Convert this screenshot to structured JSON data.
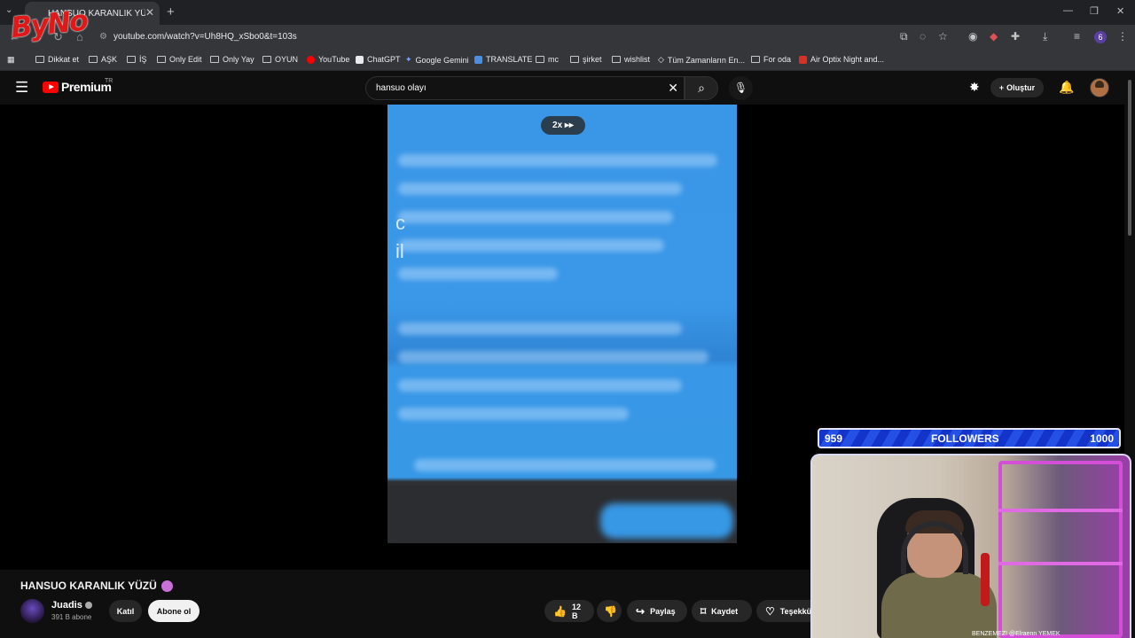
{
  "overlay": {
    "logo_text": "ByNo"
  },
  "browser": {
    "tab_title": "HANSUO KARANLIK YÜZÜ - YouTube",
    "url": "youtube.com/watch?v=Uh8HQ_xSbo0&t=103s",
    "profile_initial": "6",
    "bookmarks": [
      {
        "label": "Dikkat et",
        "icon": "folder"
      },
      {
        "label": "AŞK",
        "icon": "folder"
      },
      {
        "label": "İŞ",
        "icon": "folder"
      },
      {
        "label": "Only Edit",
        "icon": "folder"
      },
      {
        "label": "Only Yay",
        "icon": "folder"
      },
      {
        "label": "OYUN",
        "icon": "folder"
      },
      {
        "label": "YouTube",
        "icon": "youtube"
      },
      {
        "label": "ChatGPT",
        "icon": "chatgpt"
      },
      {
        "label": "Google Gemini",
        "icon": "gemini"
      },
      {
        "label": "TRANSLATE",
        "icon": "translate"
      },
      {
        "label": "mc",
        "icon": "folder"
      },
      {
        "label": "şirket",
        "icon": "folder"
      },
      {
        "label": "wishlist",
        "icon": "folder"
      },
      {
        "label": "Tüm Zamanların En...",
        "icon": "site"
      },
      {
        "label": "For oda",
        "icon": "folder"
      },
      {
        "label": "Air Optix Night and...",
        "icon": "site-red"
      }
    ]
  },
  "youtube": {
    "brand": "Premium",
    "region": "TR",
    "search_query": "hansuo olayı",
    "create_label": "Oluştur"
  },
  "player": {
    "speed_badge": "2x ▸▸",
    "visible_letters": [
      "c",
      "il"
    ]
  },
  "video": {
    "title": "HANSUO KARANLIK YÜZÜ",
    "channel_name": "Juadis",
    "subscribers": "391 B abone",
    "join_label": "Katıl",
    "subscribe_label": "Abone ol",
    "likes": "12 B",
    "share_label": "Paylaş",
    "save_label": "Kaydet",
    "thanks_label": "Teşekkü"
  },
  "stream_overlay": {
    "followers_current": "959",
    "followers_label": "FOLLOWERS",
    "followers_goal": "1000",
    "cam_caption": "BENZEMEZ! @Elraenn YEMEK"
  }
}
